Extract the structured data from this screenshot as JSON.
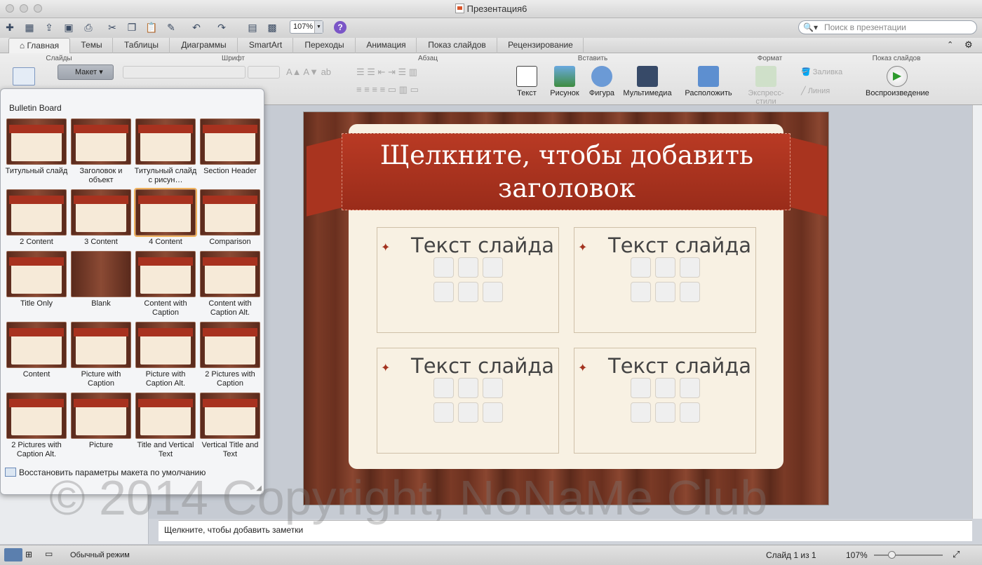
{
  "window": {
    "title": "Презентация6"
  },
  "toolbar": {
    "zoom": "107%",
    "search_placeholder": "Поиск в презентации"
  },
  "tabs": [
    "Главная",
    "Темы",
    "Таблицы",
    "Диаграммы",
    "SmartArt",
    "Переходы",
    "Анимация",
    "Показ слайдов",
    "Рецензирование"
  ],
  "ribbon": {
    "groups": {
      "slides": "Слайды",
      "font": "Шрифт",
      "paragraph": "Абзац",
      "insert": "Вставить",
      "format": "Формат",
      "slideshow": "Показ слайдов"
    },
    "layout_button": "Макет",
    "insert": {
      "text": "Текст",
      "picture": "Рисунок",
      "shape": "Фигура",
      "media": "Мультимедиа"
    },
    "format": {
      "arrange": "Расположить",
      "quick_styles": "Экспресс-стили",
      "fill": "Заливка",
      "line": "Линия"
    },
    "play": "Воспроизведение"
  },
  "layout_panel": {
    "title": "Bulletin Board",
    "items": [
      "Титульный слайд",
      "Заголовок и объект",
      "Титульный слайд с рисун…",
      "Section Header",
      "2 Content",
      "3 Content",
      "4 Content",
      "Comparison",
      "Title Only",
      "Blank",
      "Content with Caption",
      "Content with Caption Alt.",
      "Content",
      "Picture with Caption",
      "Picture with Caption Alt.",
      "2 Pictures with Caption",
      "2 Pictures with Caption Alt.",
      "Picture",
      "Title and Vertical Text",
      "Vertical Title and Text"
    ],
    "selected": "4 Content",
    "reset": "Восстановить параметры макета по умолчанию"
  },
  "slide": {
    "title": "Щелкните, чтобы добавить заголовок",
    "placeholders": [
      "Текст слайда",
      "Текст слайда",
      "Текст слайда",
      "Текст слайда"
    ]
  },
  "notes": {
    "placeholder": "Щелкните, чтобы добавить заметки"
  },
  "status": {
    "view_mode": "Обычный режим",
    "slide_counter": "Слайд 1 из 1",
    "zoom": "107%"
  },
  "watermark": "© 2014 Copyright, NoNaMe Club"
}
